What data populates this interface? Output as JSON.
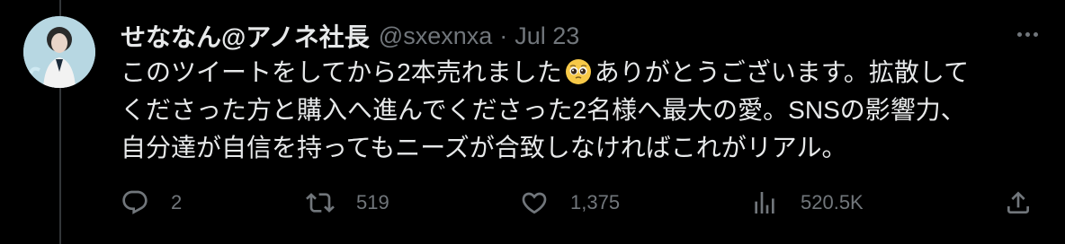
{
  "tweet": {
    "author": {
      "display_name": "せななん@アノネ社長",
      "handle": "@sxexnxa",
      "separator": "·",
      "date": "Jul 23"
    },
    "text": {
      "line1_a": "このツイートをしてから2本売れました",
      "emoji": "pleading-face-emoji",
      "line1_b": "ありがとうございます。拡散して",
      "line2": "くださった方と購入へ進んでくださった2名様へ最大の愛。SNSの影響力、",
      "line3": "自分達が自信を持ってもニーズが合致しなければこれがリアル。"
    },
    "actions": {
      "replies": "2",
      "retweets": "519",
      "likes": "1,375",
      "views": "520.5K"
    }
  },
  "colors": {
    "background": "#000000",
    "primary_text": "#e7e9ea",
    "secondary_text": "#71767b",
    "thread_line": "#333639"
  },
  "icons": [
    "reply-icon",
    "retweet-icon",
    "like-icon",
    "views-icon",
    "share-icon",
    "more-icon"
  ]
}
